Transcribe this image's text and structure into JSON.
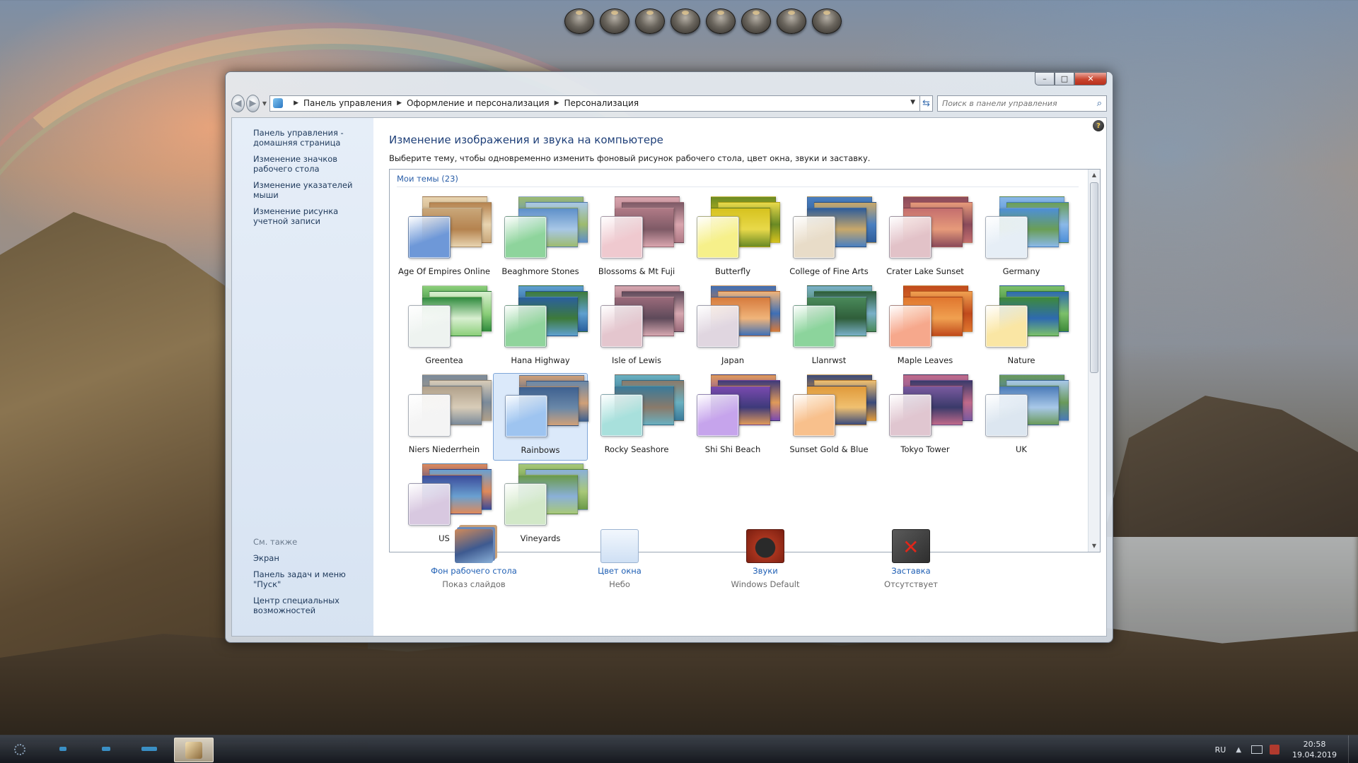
{
  "window": {
    "minimize": "–",
    "maximize": "□",
    "close": "✕"
  },
  "nav": {
    "back_icon": "back-arrow",
    "forward_icon": "forward-arrow",
    "breadcrumb": [
      "Панель управления",
      "Оформление и персонализация",
      "Персонализация"
    ],
    "search_placeholder": "Поиск в панели управления"
  },
  "sidebar": {
    "links": [
      "Панель управления - домашняя страница",
      "Изменение значков рабочего стола",
      "Изменение указателей мыши",
      "Изменение рисунка учетной записи"
    ],
    "see_also_title": "См. также",
    "see_also": [
      "Экран",
      "Панель задач и меню \"Пуск\"",
      "Центр специальных возможностей"
    ]
  },
  "main": {
    "title": "Изменение изображения и звука на компьютере",
    "description": "Выберите тему, чтобы одновременно изменить фоновый рисунок рабочего стола, цвет окна, звуки и заставку.",
    "group_label": "Мои темы (23)",
    "selected_theme": "Rainbows",
    "themes": [
      {
        "name": "Age Of Empires Online",
        "front": "#6e98d8",
        "back": [
          "#c9a77a",
          "#e8d4b0",
          "#b5834f"
        ]
      },
      {
        "name": "Beaghmore Stones",
        "front": "#8ed49c",
        "back": [
          "#5d8fc9",
          "#9dbb6f",
          "#a8c7e6"
        ]
      },
      {
        "name": "Blossoms & Mt Fuji",
        "front": "#efc9cf",
        "back": [
          "#b07a86",
          "#d9a5ae",
          "#7e5a66"
        ]
      },
      {
        "name": "Butterfly",
        "front": "#f6f08a",
        "back": [
          "#d6c21e",
          "#6a8a24",
          "#e8d94a"
        ]
      },
      {
        "name": "College of Fine Arts",
        "front": "#e8dcc8",
        "back": [
          "#2f5d9a",
          "#4a7fc0",
          "#c8a86a"
        ]
      },
      {
        "name": "Crater Lake Sunset",
        "front": "#e2c2c8",
        "back": [
          "#c46e6e",
          "#8a4a5a",
          "#e69a7a"
        ]
      },
      {
        "name": "Germany",
        "front": "#e6eef6",
        "back": [
          "#4d8fd8",
          "#8ab8e8",
          "#6a9e56"
        ]
      },
      {
        "name": "Greentea",
        "front": "#eef3f0",
        "back": [
          "#2e8a3c",
          "#8ccf7a",
          "#d8efd0"
        ]
      },
      {
        "name": "Hana Highway",
        "front": "#90d49c",
        "back": [
          "#2a5f9e",
          "#5fa0cf",
          "#3d7a3a"
        ]
      },
      {
        "name": "Isle of Lewis",
        "front": "#e4c6ce",
        "back": [
          "#9a6a7a",
          "#d6a7b0",
          "#5e4a5a"
        ]
      },
      {
        "name": "Japan",
        "front": "#e0d6e0",
        "back": [
          "#d67a3c",
          "#3e6fb6",
          "#f0b47a"
        ]
      },
      {
        "name": "Llanrwst",
        "front": "#8cd49c",
        "back": [
          "#4a8a5a",
          "#7ab0c8",
          "#2f5e3a"
        ]
      },
      {
        "name": "Maple Leaves",
        "front": "#f6a88c",
        "back": [
          "#e0762e",
          "#c04a1c",
          "#f0a050"
        ]
      },
      {
        "name": "Nature",
        "front": "#fae6a4",
        "back": [
          "#3e8a3a",
          "#7cc06a",
          "#2e6ab0"
        ]
      },
      {
        "name": "Niers Niederrhein",
        "front": "#f4f4f4",
        "back": [
          "#b0a08a",
          "#7a8a9a",
          "#d8ccb8"
        ]
      },
      {
        "name": "Rainbows",
        "front": "#9ec4f0",
        "back": [
          "#3e6090",
          "#d0a078",
          "#6a88a8"
        ]
      },
      {
        "name": "Rocky Seashore",
        "front": "#a8e0dc",
        "back": [
          "#3a7a9a",
          "#6ab0c0",
          "#8a7a6a"
        ]
      },
      {
        "name": "Shi Shi Beach",
        "front": "#c6a4ec",
        "back": [
          "#7a4ab0",
          "#e09a5a",
          "#3e3a7a"
        ]
      },
      {
        "name": "Sunset Gold & Blue",
        "front": "#f8c08c",
        "back": [
          "#e09a3a",
          "#3a4a7a",
          "#f0c070"
        ]
      },
      {
        "name": "Tokyo Tower",
        "front": "#e0c6d0",
        "back": [
          "#7a5aa0",
          "#c06a8a",
          "#3a3a6a"
        ]
      },
      {
        "name": "UK",
        "front": "#dce6f0",
        "back": [
          "#4a7ab8",
          "#6a9a5a",
          "#a8c8e8"
        ]
      },
      {
        "name": "US",
        "front": "#d8c8e0",
        "back": [
          "#3a4a9a",
          "#e08a5a",
          "#6aa0d0"
        ]
      },
      {
        "name": "Vineyards",
        "front": "#d2e8c8",
        "back": [
          "#6a9a4a",
          "#a8c878",
          "#8ab0d8"
        ]
      }
    ]
  },
  "bottom": [
    {
      "label": "Фон рабочего стола",
      "sub": "Показ слайдов",
      "icon": "desktop-background-icon"
    },
    {
      "label": "Цвет окна",
      "sub": "Небо",
      "icon": "window-color-icon"
    },
    {
      "label": "Звуки",
      "sub": "Windows Default",
      "icon": "sounds-icon"
    },
    {
      "label": "Заставка",
      "sub": "Отсутствует",
      "icon": "screensaver-icon"
    }
  ],
  "taskbar": {
    "language": "RU",
    "time": "20:58",
    "date": "19.04.2019"
  },
  "colors": {
    "link": "#1f5fb4",
    "title": "#1e3f78",
    "close": "#c9452f",
    "selection": "#7fa6d8"
  }
}
